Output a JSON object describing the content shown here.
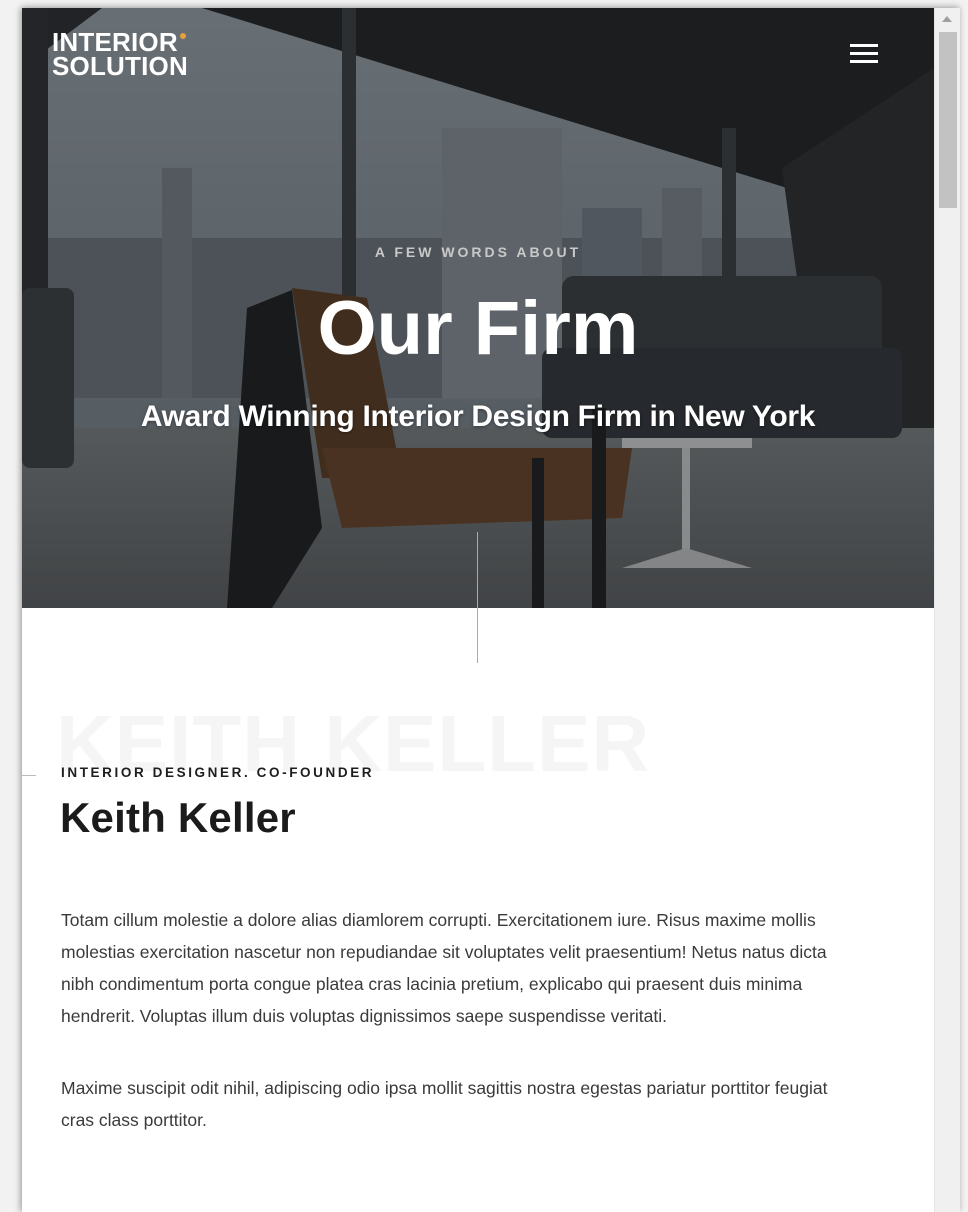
{
  "logo": {
    "line1": "INTERIOR",
    "line2": "SOLUTION"
  },
  "hero": {
    "eyebrow": "A FEW WORDS ABOUT",
    "title": "Our Firm",
    "subtitle": "Award Winning Interior Design Firm in New York"
  },
  "profile": {
    "watermark": "KEITH KELLER",
    "role": "INTERIOR DESIGNER. CO-FOUNDER",
    "name": "Keith Keller",
    "bio_paragraph_1": "Totam cillum molestie a dolore alias diamlorem corrupti. Exercitationem iure. Risus maxime mollis molestias exercitation nascetur non repudiandae sit voluptates velit praesentium! Netus natus dicta nibh condimentum porta congue platea cras lacinia pretium, explicabo qui praesent duis minima hendrerit. Voluptas illum duis voluptas dignissimos saepe suspendisse veritati.",
    "bio_paragraph_2": "Maxime suscipit odit nihil, adipiscing odio ipsa mollit sagittis nostra egestas pariatur porttitor feugiat cras class porttitor."
  },
  "icons": {
    "menu": "hamburger-menu-icon",
    "scroll_up": "chevron-up-icon"
  },
  "colors": {
    "accent": "#e8a13a",
    "hero_text": "#ffffff",
    "body_text": "#3a3a3a",
    "heading_text": "#1b1b1b"
  }
}
